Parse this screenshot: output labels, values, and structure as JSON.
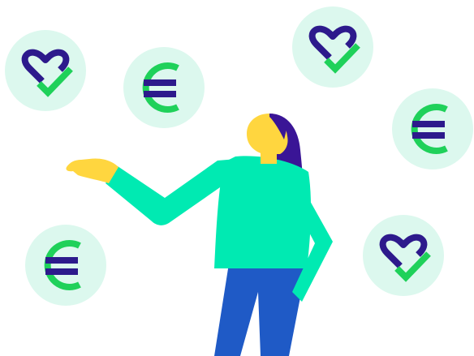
{
  "illustration": {
    "subject": "person-with-floating-icons",
    "icons": [
      {
        "name": "heart-check-icon"
      },
      {
        "name": "euro-icon"
      },
      {
        "name": "heart-check-icon"
      },
      {
        "name": "euro-icon"
      },
      {
        "name": "euro-icon"
      },
      {
        "name": "heart-check-icon"
      }
    ]
  },
  "colors": {
    "background": "#ffffff",
    "bubble": "#dcf8ee",
    "navy": "#2d1a8c",
    "green": "#1fd15a",
    "shirt": "#00eab2",
    "skin": "#ffd63f",
    "hair": "#3a1596",
    "pants": "#1f5ac6"
  }
}
